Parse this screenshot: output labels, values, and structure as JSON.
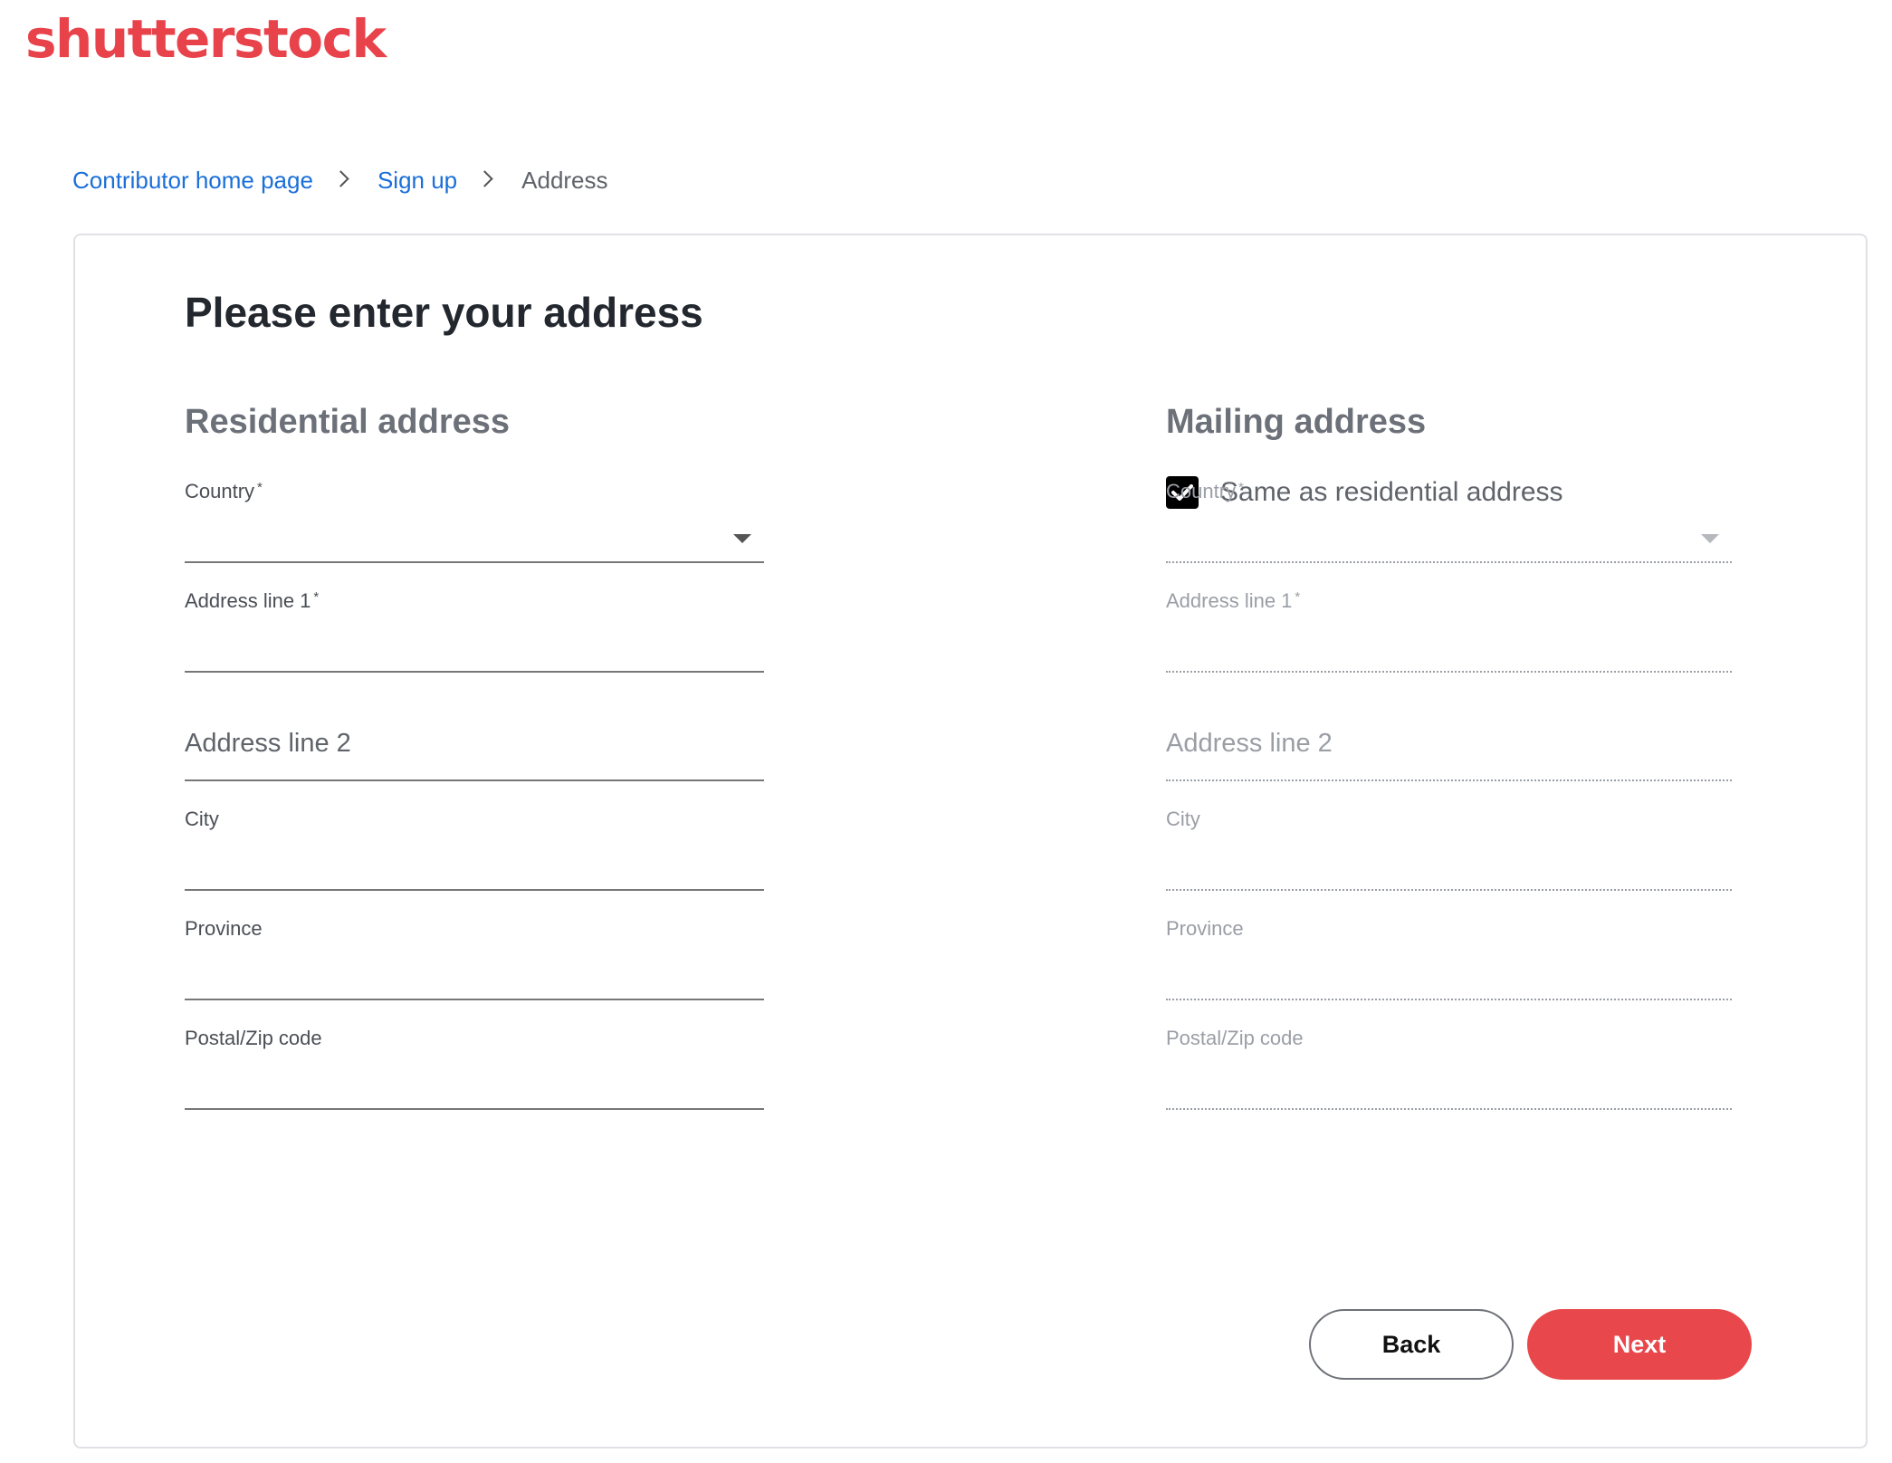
{
  "header": {
    "logo_text": "shutterstock"
  },
  "breadcrumb": {
    "items": [
      {
        "label": "Contributor home page"
      },
      {
        "label": "Sign up"
      }
    ],
    "current": "Address"
  },
  "page": {
    "title": "Please enter your address"
  },
  "residential": {
    "title": "Residential address",
    "fields": {
      "country": {
        "label": "Country",
        "required_mark": "*",
        "value": ""
      },
      "address1": {
        "label": "Address line 1",
        "required_mark": "*",
        "value": ""
      },
      "address2": {
        "label": "Address line 2",
        "value": ""
      },
      "city": {
        "label": "City",
        "value": ""
      },
      "province": {
        "label": "Province",
        "value": ""
      },
      "postal": {
        "label": "Postal/Zip code",
        "value": ""
      }
    }
  },
  "mailing": {
    "title": "Mailing address",
    "same_as_residential": {
      "label": "Same as residential address",
      "checked": true
    },
    "fields": {
      "country": {
        "label": "Country",
        "required_mark": "*",
        "value": ""
      },
      "address1": {
        "label": "Address line 1",
        "required_mark": "*",
        "value": ""
      },
      "address2": {
        "label": "Address line 2",
        "value": ""
      },
      "city": {
        "label": "City",
        "value": ""
      },
      "province": {
        "label": "Province",
        "value": ""
      },
      "postal": {
        "label": "Postal/Zip code",
        "value": ""
      }
    }
  },
  "actions": {
    "back_label": "Back",
    "next_label": "Next"
  },
  "colors": {
    "brand": "#e8424a",
    "link": "#1a6fd8",
    "next_button": "#e8474b"
  },
  "icons": {
    "breadcrumb_separator": "chevron-right-icon",
    "dropdown": "caret-down-icon",
    "checkbox": "checkmark-icon"
  }
}
